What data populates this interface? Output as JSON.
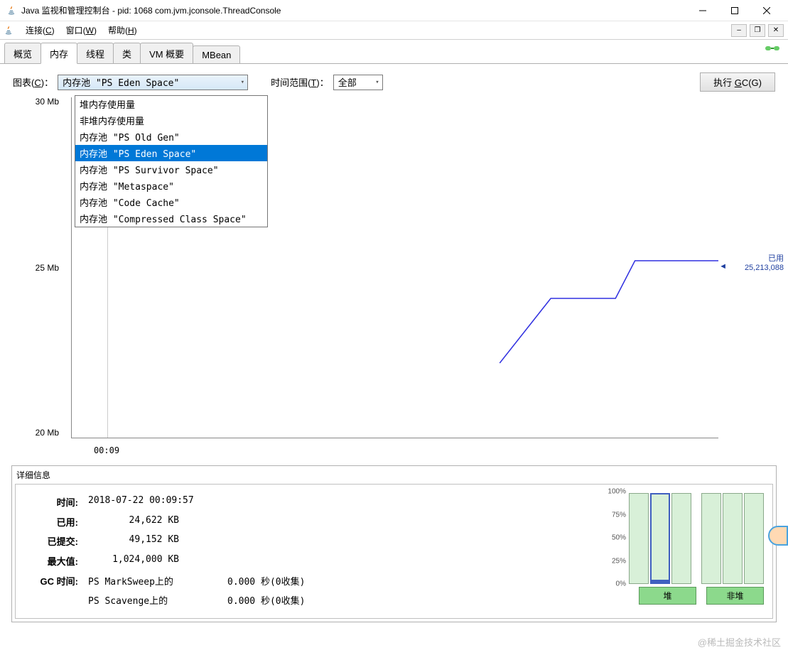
{
  "title": "Java 监视和管理控制台 - pid: 1068 com.jvm.jconsole.ThreadConsole",
  "menu": {
    "connect": "连接(C)",
    "window": "窗口(W)",
    "help": "帮助(H)"
  },
  "tabs": [
    "概览",
    "内存",
    "线程",
    "类",
    "VM 概要",
    "MBean"
  ],
  "active_tab": 1,
  "controls": {
    "chart_label": "图表(C)：",
    "chart_selected": "内存池 \"PS Eden Space\"",
    "time_label": "时间范围(T)：",
    "time_value": "全部",
    "gc_button": "执行 GC(G)"
  },
  "dropdown": {
    "items": [
      "堆内存使用量",
      "非堆内存使用量",
      "内存池 \"PS Old Gen\"",
      "内存池 \"PS Eden Space\"",
      "内存池 \"PS Survivor Space\"",
      "内存池 \"Metaspace\"",
      "内存池 \"Code Cache\"",
      "内存池 \"Compressed Class Space\""
    ],
    "selected_index": 3
  },
  "chart_data": {
    "type": "line",
    "ylabel": "Mb",
    "y_ticks": [
      20,
      25,
      30
    ],
    "x_ticks": [
      "00:09"
    ],
    "series": [
      {
        "name": "已用",
        "points": [
          [
            0.66,
            22.2
          ],
          [
            0.74,
            24.1
          ],
          [
            0.84,
            24.1
          ],
          [
            0.87,
            25.2
          ],
          [
            1.0,
            25.2
          ]
        ]
      }
    ],
    "ylim": [
      20,
      30
    ],
    "marker": {
      "label": "已用",
      "value": "25,213,088"
    }
  },
  "details": {
    "title": "详细信息",
    "rows": {
      "time_lbl": "时间:",
      "time_val": "2018-07-22 00:09:57",
      "used_lbl": "已用:",
      "used_val": "24,622 KB",
      "committed_lbl": "已提交:",
      "committed_val": "49,152 KB",
      "max_lbl": "最大值:",
      "max_val": "1,024,000 KB",
      "gc_lbl": "GC 时间:",
      "gc1_name": "PS MarkSweep上的",
      "gc1_val": "0.000 秒(0收集)",
      "gc2_name": "PS Scavenge上的",
      "gc2_val": "0.000 秒(0收集)"
    }
  },
  "bar_panel": {
    "scale": [
      "100%",
      "75%",
      "50%",
      "25%",
      "0%"
    ],
    "heap_label": "堆",
    "nonheap_label": "非堆",
    "heap_bars": [
      100,
      100,
      100
    ],
    "nonheap_bars": [
      100,
      100,
      100
    ],
    "selected_bar": 1
  },
  "watermark": "@稀土掘金技术社区"
}
